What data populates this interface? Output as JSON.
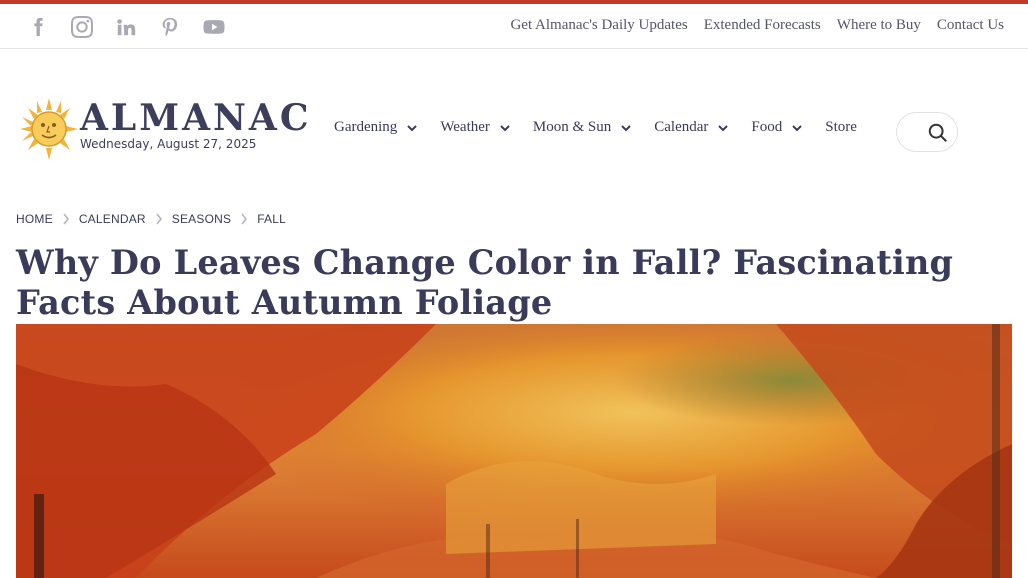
{
  "colors": {
    "accent_bar": "#c0392b",
    "text_primary": "#3a3a5a",
    "icon_gray": "#a9a9b4"
  },
  "social": [
    {
      "icon": "facebook-icon"
    },
    {
      "icon": "instagram-icon"
    },
    {
      "icon": "linkedin-icon"
    },
    {
      "icon": "pinterest-icon"
    },
    {
      "icon": "youtube-icon"
    }
  ],
  "toplinks": {
    "daily_updates": "Get Almanac's Daily Updates",
    "extended_forecasts": "Extended Forecasts",
    "where_to_buy": "Where to Buy",
    "contact_us": "Contact Us"
  },
  "logo": {
    "word": "ALMANAC",
    "date": "Wednesday, August 27, 2025"
  },
  "nav": {
    "gardening": "Gardening",
    "weather": "Weather",
    "moon_sun": "Moon & Sun",
    "calendar": "Calendar",
    "food": "Food",
    "store": "Store"
  },
  "breadcrumb": {
    "home": "HOME",
    "calendar": "CALENDAR",
    "seasons": "SEASONS",
    "fall": "FALL"
  },
  "article": {
    "title": "Why Do Leaves Change Color in Fall? Fascinating Facts About Autumn Foliage"
  }
}
